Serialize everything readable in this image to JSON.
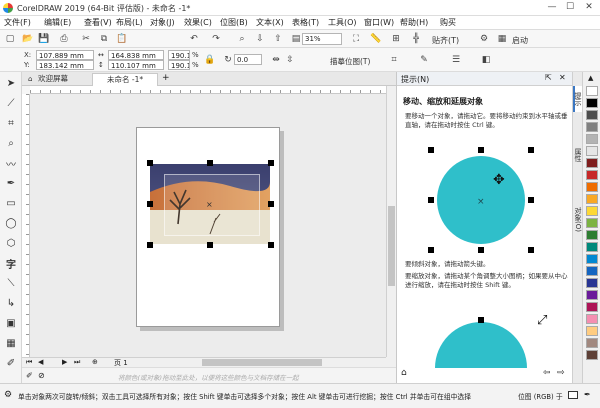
{
  "window": {
    "title": "CorelDRAW 2019 (64-Bit 评估版) - 未命名 -1*",
    "minimize": "—",
    "maximize": "☐",
    "close": "✕"
  },
  "menu": [
    "文件(F)",
    "编辑(E)",
    "查看(V)",
    "布局(L)",
    "对象(J)",
    "效果(C)",
    "位图(B)",
    "文本(X)",
    "表格(T)",
    "工具(O)",
    "窗口(W)",
    "帮助(H)",
    "购买"
  ],
  "toolbar": {
    "zoom": "31%",
    "snap_label": "贴齐(T)",
    "launch_label": "启动"
  },
  "propbar": {
    "x_label": "X:",
    "x_value": "107.889 mm",
    "y_label": "Y:",
    "y_value": "183.142 mm",
    "w_value": "164.838 mm",
    "h_value": "110.107 mm",
    "scale_w": "190.1",
    "scale_h": "190.1",
    "scale_unit": "%",
    "angle": "0.0",
    "trace_label": "描摹位图(T)"
  },
  "tabs": {
    "welcome": "欢迎屏幕",
    "doc": "未命名 -1*"
  },
  "pagenav": {
    "page": "页 1"
  },
  "canvas_hint": "将颜色(或对象)拖动至此处，以便将这些颜色与文档存储在一起",
  "docker": {
    "header": "提示(N)",
    "heading": "移动、缩放和延展对象",
    "para1": "要移动一个对象，请拖动它。要将移动约束到水平轴或垂直轴，请在拖动时按住 Ctrl 键。",
    "para2": "要倾斜对象，请拖动箭头键。",
    "para3": "要缩放对象，请拖动某个角调整大小图柄；如果要从中心进行缩放，请在拖动时按住 Shift 键。",
    "circle_color": "#2fbfca"
  },
  "vtabs": [
    "提示",
    "属性",
    "对象(O)"
  ],
  "palette": [
    "#ffffff",
    "#000000",
    "#4d4d4d",
    "#808080",
    "#b3b3b3",
    "#e6e6e6",
    "#7f1d1d",
    "#c62828",
    "#ef6c00",
    "#f9a825",
    "#fdd835",
    "#7cb342",
    "#2e7d32",
    "#00897b",
    "#0288d1",
    "#1565c0",
    "#283593",
    "#6a1b9a",
    "#ad1457",
    "#f48fb1",
    "#ffcc80",
    "#a1887f",
    "#5d4037"
  ],
  "status": {
    "message": "单击对象两次可旋转/倾斜；双击工具可选择所有对象；按住 Shift 键单击可选择多个对象；按住 Alt 键单击可进行挖掘；按住 Ctrl 并单击可在组中选择",
    "color_mode": "位图 (RGB) 于"
  }
}
